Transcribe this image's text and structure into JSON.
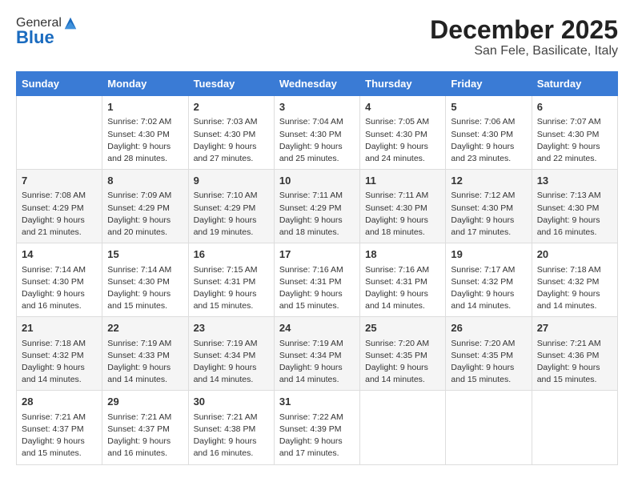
{
  "header": {
    "logo_line1": "General",
    "logo_line2": "Blue",
    "title": "December 2025",
    "subtitle": "San Fele, Basilicate, Italy"
  },
  "columns": [
    "Sunday",
    "Monday",
    "Tuesday",
    "Wednesday",
    "Thursday",
    "Friday",
    "Saturday"
  ],
  "weeks": [
    [
      {
        "day": "",
        "info": ""
      },
      {
        "day": "1",
        "info": "Sunrise: 7:02 AM\nSunset: 4:30 PM\nDaylight: 9 hours\nand 28 minutes."
      },
      {
        "day": "2",
        "info": "Sunrise: 7:03 AM\nSunset: 4:30 PM\nDaylight: 9 hours\nand 27 minutes."
      },
      {
        "day": "3",
        "info": "Sunrise: 7:04 AM\nSunset: 4:30 PM\nDaylight: 9 hours\nand 25 minutes."
      },
      {
        "day": "4",
        "info": "Sunrise: 7:05 AM\nSunset: 4:30 PM\nDaylight: 9 hours\nand 24 minutes."
      },
      {
        "day": "5",
        "info": "Sunrise: 7:06 AM\nSunset: 4:30 PM\nDaylight: 9 hours\nand 23 minutes."
      },
      {
        "day": "6",
        "info": "Sunrise: 7:07 AM\nSunset: 4:30 PM\nDaylight: 9 hours\nand 22 minutes."
      }
    ],
    [
      {
        "day": "7",
        "info": "Sunrise: 7:08 AM\nSunset: 4:29 PM\nDaylight: 9 hours\nand 21 minutes."
      },
      {
        "day": "8",
        "info": "Sunrise: 7:09 AM\nSunset: 4:29 PM\nDaylight: 9 hours\nand 20 minutes."
      },
      {
        "day": "9",
        "info": "Sunrise: 7:10 AM\nSunset: 4:29 PM\nDaylight: 9 hours\nand 19 minutes."
      },
      {
        "day": "10",
        "info": "Sunrise: 7:11 AM\nSunset: 4:29 PM\nDaylight: 9 hours\nand 18 minutes."
      },
      {
        "day": "11",
        "info": "Sunrise: 7:11 AM\nSunset: 4:30 PM\nDaylight: 9 hours\nand 18 minutes."
      },
      {
        "day": "12",
        "info": "Sunrise: 7:12 AM\nSunset: 4:30 PM\nDaylight: 9 hours\nand 17 minutes."
      },
      {
        "day": "13",
        "info": "Sunrise: 7:13 AM\nSunset: 4:30 PM\nDaylight: 9 hours\nand 16 minutes."
      }
    ],
    [
      {
        "day": "14",
        "info": "Sunrise: 7:14 AM\nSunset: 4:30 PM\nDaylight: 9 hours\nand 16 minutes."
      },
      {
        "day": "15",
        "info": "Sunrise: 7:14 AM\nSunset: 4:30 PM\nDaylight: 9 hours\nand 15 minutes."
      },
      {
        "day": "16",
        "info": "Sunrise: 7:15 AM\nSunset: 4:31 PM\nDaylight: 9 hours\nand 15 minutes."
      },
      {
        "day": "17",
        "info": "Sunrise: 7:16 AM\nSunset: 4:31 PM\nDaylight: 9 hours\nand 15 minutes."
      },
      {
        "day": "18",
        "info": "Sunrise: 7:16 AM\nSunset: 4:31 PM\nDaylight: 9 hours\nand 14 minutes."
      },
      {
        "day": "19",
        "info": "Sunrise: 7:17 AM\nSunset: 4:32 PM\nDaylight: 9 hours\nand 14 minutes."
      },
      {
        "day": "20",
        "info": "Sunrise: 7:18 AM\nSunset: 4:32 PM\nDaylight: 9 hours\nand 14 minutes."
      }
    ],
    [
      {
        "day": "21",
        "info": "Sunrise: 7:18 AM\nSunset: 4:32 PM\nDaylight: 9 hours\nand 14 minutes."
      },
      {
        "day": "22",
        "info": "Sunrise: 7:19 AM\nSunset: 4:33 PM\nDaylight: 9 hours\nand 14 minutes."
      },
      {
        "day": "23",
        "info": "Sunrise: 7:19 AM\nSunset: 4:34 PM\nDaylight: 9 hours\nand 14 minutes."
      },
      {
        "day": "24",
        "info": "Sunrise: 7:19 AM\nSunset: 4:34 PM\nDaylight: 9 hours\nand 14 minutes."
      },
      {
        "day": "25",
        "info": "Sunrise: 7:20 AM\nSunset: 4:35 PM\nDaylight: 9 hours\nand 14 minutes."
      },
      {
        "day": "26",
        "info": "Sunrise: 7:20 AM\nSunset: 4:35 PM\nDaylight: 9 hours\nand 15 minutes."
      },
      {
        "day": "27",
        "info": "Sunrise: 7:21 AM\nSunset: 4:36 PM\nDaylight: 9 hours\nand 15 minutes."
      }
    ],
    [
      {
        "day": "28",
        "info": "Sunrise: 7:21 AM\nSunset: 4:37 PM\nDaylight: 9 hours\nand 15 minutes."
      },
      {
        "day": "29",
        "info": "Sunrise: 7:21 AM\nSunset: 4:37 PM\nDaylight: 9 hours\nand 16 minutes."
      },
      {
        "day": "30",
        "info": "Sunrise: 7:21 AM\nSunset: 4:38 PM\nDaylight: 9 hours\nand 16 minutes."
      },
      {
        "day": "31",
        "info": "Sunrise: 7:22 AM\nSunset: 4:39 PM\nDaylight: 9 hours\nand 17 minutes."
      },
      {
        "day": "",
        "info": ""
      },
      {
        "day": "",
        "info": ""
      },
      {
        "day": "",
        "info": ""
      }
    ]
  ]
}
